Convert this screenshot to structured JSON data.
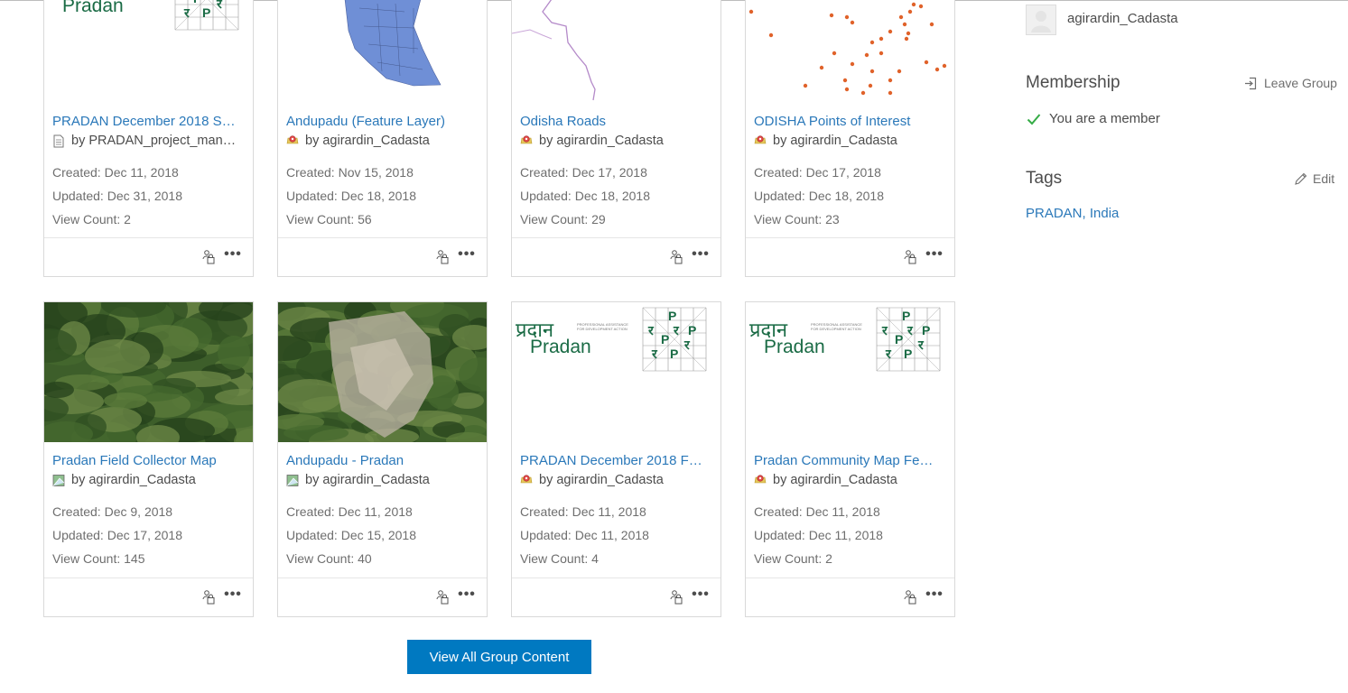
{
  "cards": [
    {
      "title": "PRADAN December 2018 S…",
      "owner": "by PRADAN_project_man…",
      "owner_icon": "document-icon",
      "created": "Created: Dec 11, 2018",
      "updated": "Updated: Dec 31, 2018",
      "views": "View Count: 2",
      "thumb": "pradan-logo"
    },
    {
      "title": "Andupadu (Feature Layer)",
      "owner": "by agirardin_Cadasta",
      "owner_icon": "feature-layer-icon",
      "created": "Created: Nov 15, 2018",
      "updated": "Updated: Dec 18, 2018",
      "views": "View Count: 56",
      "thumb": "blue-parcels-map"
    },
    {
      "title": "Odisha Roads",
      "owner": "by agirardin_Cadasta",
      "owner_icon": "feature-layer-icon",
      "created": "Created: Dec 17, 2018",
      "updated": "Updated: Dec 18, 2018",
      "views": "View Count: 29",
      "thumb": "roads-map"
    },
    {
      "title": "ODISHA Points of Interest",
      "owner": "by agirardin_Cadasta",
      "owner_icon": "feature-layer-icon",
      "created": "Created: Dec 17, 2018",
      "updated": "Updated: Dec 18, 2018",
      "views": "View Count: 23",
      "thumb": "points-map"
    },
    {
      "title": "Pradan Field Collector Map",
      "owner": "by agirardin_Cadasta",
      "owner_icon": "web-map-icon",
      "created": "Created: Dec 9, 2018",
      "updated": "Updated: Dec 17, 2018",
      "views": "View Count: 145",
      "thumb": "satellite-forest"
    },
    {
      "title": "Andupadu - Pradan",
      "owner": "by agirardin_Cadasta",
      "owner_icon": "web-map-icon",
      "created": "Created: Dec 11, 2018",
      "updated": "Updated: Dec 15, 2018",
      "views": "View Count: 40",
      "thumb": "satellite-village"
    },
    {
      "title": "PRADAN December 2018 F…",
      "owner": "by agirardin_Cadasta",
      "owner_icon": "feature-layer-icon",
      "created": "Created: Dec 11, 2018",
      "updated": "Updated: Dec 11, 2018",
      "views": "View Count: 4",
      "thumb": "pradan-logo"
    },
    {
      "title": "Pradan Community Map Fe…",
      "owner": "by agirardin_Cadasta",
      "owner_icon": "feature-layer-icon",
      "created": "Created: Dec 11, 2018",
      "updated": "Updated: Dec 11, 2018",
      "views": "View Count: 2",
      "thumb": "pradan-logo"
    }
  ],
  "logo": {
    "hindi": "प्रदान",
    "latin": "Pradan",
    "tagline_1": "PROFESSIONAL ASSISTANCE",
    "tagline_2": "FOR DEVELOPMENT ACTION"
  },
  "view_all_label": "View All Group Content",
  "sidebar": {
    "owner_name": "agirardin_Cadasta",
    "membership_title": "Membership",
    "leave_group": "Leave Group",
    "member_status": "You are a member",
    "tags_title": "Tags",
    "edit_label": "Edit",
    "tags": "PRADAN, India"
  },
  "colors": {
    "link": "#2a78b9",
    "button": "#0079c1",
    "logo_green": "#1a6b45",
    "check": "#35ac46"
  }
}
